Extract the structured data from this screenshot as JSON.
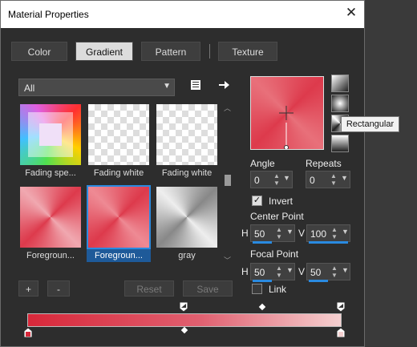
{
  "window": {
    "title": "Material Properties",
    "close_symbol": "✕"
  },
  "tabs": [
    {
      "label": "Color"
    },
    {
      "label": "Gradient"
    },
    {
      "label": "Pattern"
    },
    {
      "label": "Texture"
    }
  ],
  "category": {
    "value": "All"
  },
  "thumbnails": [
    {
      "caption": "Fading spe..."
    },
    {
      "caption": "Fading white"
    },
    {
      "caption": "Fading white"
    },
    {
      "caption": "Foregroun..."
    },
    {
      "caption": "Foregroun..."
    },
    {
      "caption": "gray"
    }
  ],
  "list_buttons": {
    "add": "+",
    "remove": "-",
    "reset": "Reset",
    "save": "Save"
  },
  "tooltip": "Rectangular",
  "angle": {
    "label": "Angle",
    "value": "0"
  },
  "repeats": {
    "label": "Repeats",
    "value": "0"
  },
  "invert": {
    "label": "Invert",
    "checked": true,
    "check_mark": "✓"
  },
  "center_point": {
    "label": "Center Point",
    "h_label": "H",
    "h_value": "50",
    "v_label": "V",
    "v_value": "100"
  },
  "focal_point": {
    "label": "Focal Point",
    "h_label": "H",
    "h_value": "50",
    "v_label": "V",
    "v_value": "50"
  },
  "link": {
    "label": "Link",
    "checked": false
  },
  "colors": {
    "gradient_start": "#d8283a",
    "gradient_end": "#f5d0d0",
    "accent": "#2a8ae0"
  }
}
